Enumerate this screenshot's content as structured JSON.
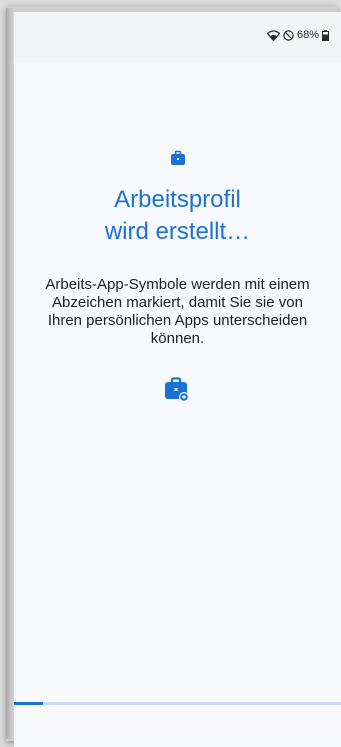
{
  "status_bar": {
    "battery_text": "68%",
    "icons": [
      "wifi-icon",
      "do-not-disturb-icon",
      "battery-icon"
    ]
  },
  "main": {
    "title_line1": "Arbeitsprofil",
    "title_line2": "wird erstellt…",
    "description": "Arbeits-App-Symbole werden mit einem Abzeichen markiert, damit Sie sie von Ihren persönlichen Apps unterscheiden können.",
    "top_icon": "briefcase-icon",
    "badge_icon": "work-badge-briefcase-icon"
  },
  "progress": {
    "fraction": 0.09
  },
  "colors": {
    "accent": "#1a72d6",
    "progress_track": "#c6dcf4",
    "background": "#f8f9fd",
    "text": "#202124"
  }
}
